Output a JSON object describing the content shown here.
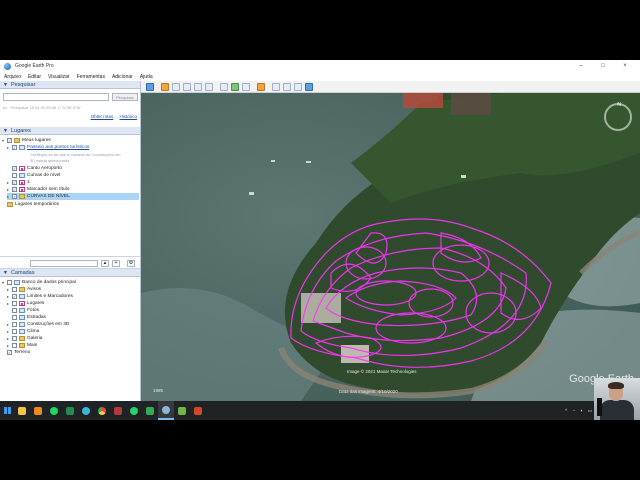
{
  "window": {
    "title": "Google Earth Pro",
    "controls": [
      "–",
      "□",
      "×"
    ]
  },
  "menu": [
    "Arquivo",
    "Editar",
    "Visualizar",
    "Ferramentas",
    "Adicionar",
    "Ajuda"
  ],
  "search": {
    "header": "Pesquisar",
    "input_value": "",
    "button_label": "Pesquisar",
    "hint": "ex.: Pesquisar 18 04 00 09:46 1? N 56' 5\"W",
    "links": [
      "Obter rotas",
      "Histórico"
    ]
  },
  "places": {
    "header": "Lugares",
    "items": [
      {
        "label": "Meus lugares",
        "level": 0
      },
      {
        "label": "Passeio aos pontos turísticos",
        "level": 1
      },
      {
        "label": "Certifique-se de que a camada de Construções em",
        "level": 2
      },
      {
        "label": "3D esteja selecionada",
        "level": 2
      },
      {
        "label": "Canto Aeroporto",
        "level": 1
      },
      {
        "label": "Curvas de nível",
        "level": 1
      },
      {
        "label": "1",
        "level": 1
      },
      {
        "label": "Marcador sem título",
        "level": 1
      },
      {
        "label": "CURVAS DE NÍVEL",
        "level": 1
      },
      {
        "label": "Lugares temporários",
        "level": 0
      }
    ]
  },
  "layers": {
    "header": "Camadas",
    "items": [
      {
        "label": "Banco de dados principal",
        "level": 0
      },
      {
        "label": "Avisos",
        "level": 1
      },
      {
        "label": "Limites e Marcadores",
        "level": 1
      },
      {
        "label": "Lugares",
        "level": 1
      },
      {
        "label": "Fotos",
        "level": 1
      },
      {
        "label": "Estradas",
        "level": 1
      },
      {
        "label": "Construções em 3D",
        "level": 1
      },
      {
        "label": "Clima",
        "level": 1
      },
      {
        "label": "Galeria",
        "level": 1
      },
      {
        "label": "Mais",
        "level": 1
      },
      {
        "label": "Terreno",
        "level": 0
      }
    ]
  },
  "map": {
    "copyright": "Image © 2021 Maxar Technologies",
    "imagery_date": "Data das imagens: 4/10/2020",
    "year_label": "1985",
    "watermark": "Google Earth",
    "north_label": "N",
    "contour_color": "#ff33ff"
  },
  "taskbar": {
    "apps": [
      "explorer",
      "vlc",
      "spotify",
      "sheets",
      "edge",
      "chrome",
      "media",
      "whatsapp",
      "camtasia",
      "google-earth",
      "qgis",
      "ppt"
    ],
    "active_app": "google-earth"
  },
  "colors": {
    "accent": "#1d3f77",
    "selection": "#aad4f5",
    "contour": "#ff33ff"
  }
}
